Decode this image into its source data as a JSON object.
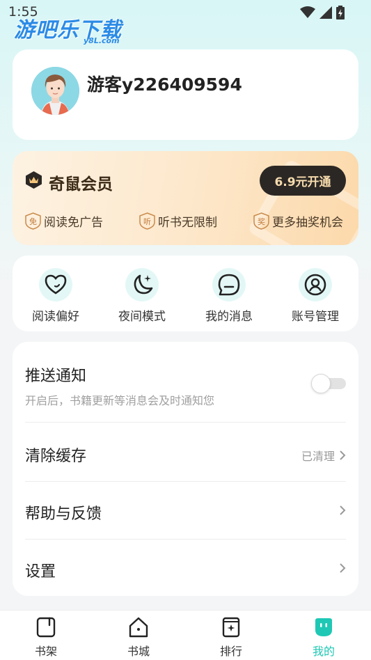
{
  "status": {
    "time": "1:55"
  },
  "watermark": {
    "main": "游吧乐下载",
    "sub": "y8L.com"
  },
  "profile": {
    "username": "游客y226409594"
  },
  "vip": {
    "title": "奇鼠会员",
    "button": "6.9元开通",
    "perks": [
      {
        "badge": "免",
        "label": "阅读免广告"
      },
      {
        "badge": "听",
        "label": "听书无限制"
      },
      {
        "badge": "奖",
        "label": "更多抽奖机会"
      }
    ]
  },
  "quick_actions": [
    {
      "label": "阅读偏好",
      "icon": "heart-icon"
    },
    {
      "label": "夜间模式",
      "icon": "moon-icon"
    },
    {
      "label": "我的消息",
      "icon": "message-icon"
    },
    {
      "label": "账号管理",
      "icon": "account-icon"
    }
  ],
  "settings": {
    "push": {
      "title": "推送通知",
      "subtitle": "开启后，书籍更新等消息会及时通知您",
      "enabled": false
    },
    "cache": {
      "title": "清除缓存",
      "status": "已清理"
    },
    "help": {
      "title": "帮助与反馈"
    },
    "prefs": {
      "title": "设置"
    }
  },
  "tabs": [
    {
      "label": "书架",
      "icon": "bookshelf-icon",
      "active": false
    },
    {
      "label": "书城",
      "icon": "bookstore-icon",
      "active": false
    },
    {
      "label": "排行",
      "icon": "ranking-icon",
      "active": false
    },
    {
      "label": "我的",
      "icon": "profile-icon",
      "active": true
    }
  ],
  "colors": {
    "accent": "#1ec8b4",
    "vip_button": "#2b2724",
    "vip_text": "#f7dcae"
  }
}
